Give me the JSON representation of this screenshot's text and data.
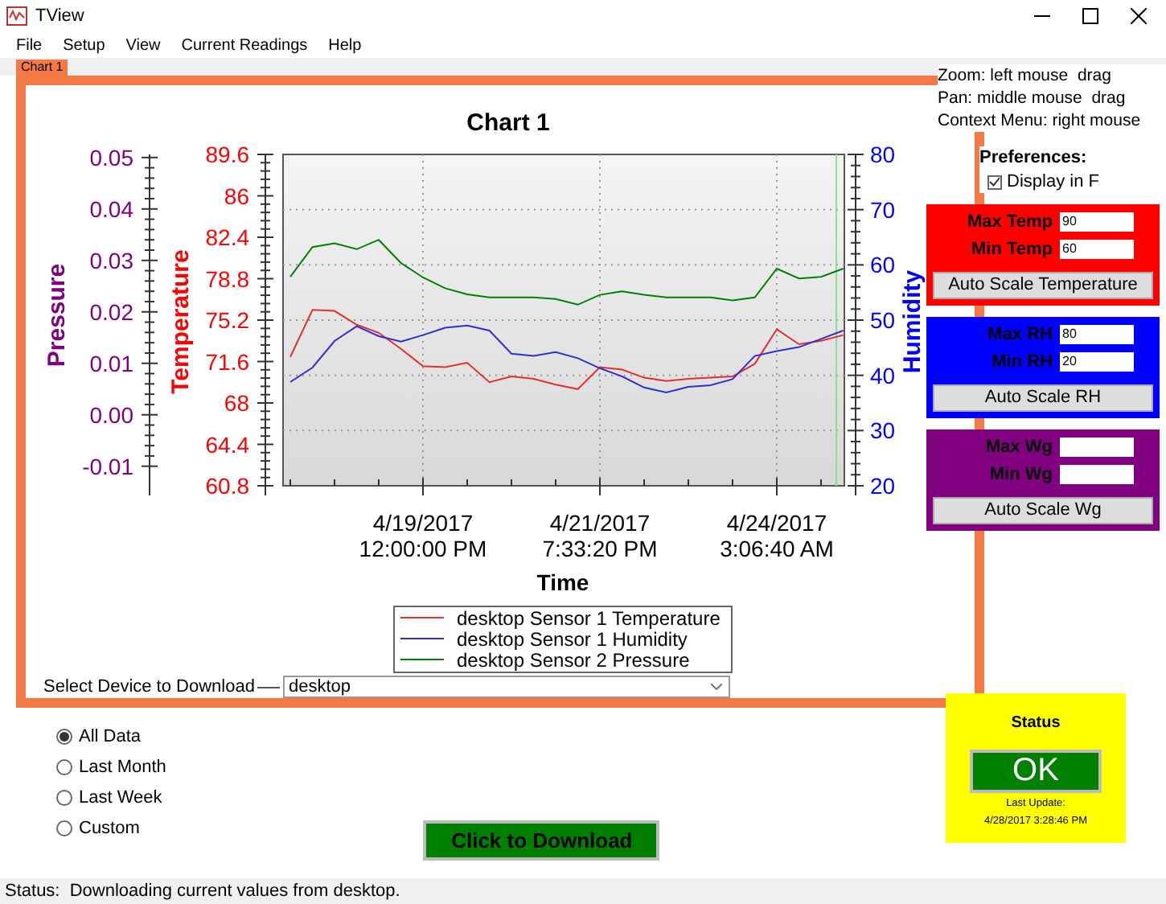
{
  "window": {
    "title": "TView"
  },
  "menu": [
    "File",
    "Setup",
    "View",
    "Current Readings",
    "Help"
  ],
  "tabs": [
    {
      "label": "Chart 1",
      "selected": true
    }
  ],
  "chart": {
    "chart_data": {
      "type": "line",
      "title": "Chart 1",
      "xlabel": "Time",
      "grid": true,
      "legend": "bottom",
      "categories": [
        null,
        null,
        null,
        null,
        null,
        null,
        "4/19/2017\n12:00:00 PM",
        null,
        null,
        null,
        null,
        null,
        null,
        null,
        "4/21/2017\n7:33:20 PM",
        null,
        null,
        null,
        null,
        null,
        null,
        null,
        "4/24/2017\n3:06:40 AM",
        null,
        null,
        null
      ],
      "ylabel": "Temperature",
      "ylim": [
        60.8,
        89.6
      ],
      "yticks": [
        {
          "value": 89.6,
          "label": "89.6"
        },
        {
          "value": 86,
          "label": "86"
        },
        {
          "value": 82.4,
          "label": "82.4"
        },
        {
          "value": 78.8,
          "label": "78.8"
        },
        {
          "value": 75.2,
          "label": "75.2"
        },
        {
          "value": 71.6,
          "label": "71.6"
        },
        {
          "value": 68,
          "label": "68"
        },
        {
          "value": 64.4,
          "label": "64.4"
        },
        {
          "value": 60.8,
          "label": "60.8"
        }
      ],
      "y2label": "Humidity",
      "y2lim": [
        20,
        80
      ],
      "y2ticks": [
        {
          "value": 80,
          "label": "80"
        },
        {
          "value": 70,
          "label": "70"
        },
        {
          "value": 60,
          "label": "60"
        },
        {
          "value": 50,
          "label": "50"
        },
        {
          "value": 40,
          "label": "40"
        },
        {
          "value": 30,
          "label": "30"
        },
        {
          "value": 20,
          "label": "20"
        }
      ],
      "y3label": "Pressure",
      "y3lim": [
        -0.0138,
        0.0506
      ],
      "y3ticks": [
        {
          "value": 0.05,
          "label": "0.05"
        },
        {
          "value": 0.04,
          "label": "0.04"
        },
        {
          "value": 0.03,
          "label": "0.03"
        },
        {
          "value": 0.02,
          "label": "0.02"
        },
        {
          "value": 0.01,
          "label": "0.01"
        },
        {
          "value": 0,
          "label": "0.00"
        },
        {
          "value": -0.01,
          "label": "-0.01"
        }
      ],
      "series": [
        {
          "name": "desktop Sensor 1 Temperature",
          "color": "#e03030",
          "values": [
            72.0,
            76.1,
            76.0,
            74.8,
            74.1,
            72.7,
            71.2,
            71.1,
            71.5,
            69.8,
            70.3,
            70.1,
            69.6,
            69.2,
            71.1,
            70.9,
            70.2,
            69.9,
            70.1,
            70.2,
            70.3,
            71.4,
            74.4,
            73.1,
            73.4,
            73.9
          ]
        },
        {
          "name": "desktop Sensor 1 Humidity",
          "color": "#3030d0",
          "axis": "y2",
          "values": [
            38.8,
            41.4,
            46.2,
            48.9,
            47.1,
            46.1,
            47.3,
            48.6,
            49.0,
            48.1,
            43.9,
            43.5,
            44.2,
            43.1,
            41.3,
            39.8,
            37.8,
            36.9,
            37.9,
            38.2,
            39.3,
            43.5,
            44.4,
            45.1,
            46.6,
            48.1
          ]
        },
        {
          "name": "desktop Sensor 2 Pressure",
          "color": "#008000",
          "axis": "y3",
          "values": [
            0.0268,
            0.0326,
            0.0333,
            0.0322,
            0.034,
            0.0295,
            0.0267,
            0.0246,
            0.0234,
            0.0228,
            0.0228,
            0.0228,
            0.0225,
            0.0214,
            0.0233,
            0.024,
            0.0233,
            0.0228,
            0.0228,
            0.0228,
            0.0222,
            0.0228,
            0.0284,
            0.0265,
            0.0268,
            0.0284
          ]
        }
      ]
    }
  },
  "device_select": {
    "label": "Select Device to Download",
    "value": "desktop"
  },
  "hints": [
    "Zoom: left mouse  drag",
    "Pan: middle mouse  drag",
    "Context Menu: right mouse"
  ],
  "preferences": {
    "title": "Preferences:",
    "options": [
      {
        "label": "Display in F",
        "checked": true
      }
    ]
  },
  "scale_panels": [
    {
      "color": "#ff0000",
      "fields": [
        {
          "label": "Max Temp",
          "value": "90"
        },
        {
          "label": "Min Temp",
          "value": "60"
        }
      ],
      "button": "Auto Scale Temperature"
    },
    {
      "color": "#0000ff",
      "fields": [
        {
          "label": "Max RH",
          "value": "80"
        },
        {
          "label": "Min RH",
          "value": "20"
        }
      ],
      "button": "Auto Scale RH"
    },
    {
      "color": "#800080",
      "fields": [
        {
          "label": "Max Wg"
        },
        {
          "label": "Min Wg"
        }
      ],
      "button": "Auto Scale Wg"
    }
  ],
  "range_options": [
    {
      "label": "All Data",
      "selected": true
    },
    {
      "label": "Last Month",
      "selected": false
    },
    {
      "label": "Last Week",
      "selected": false
    },
    {
      "label": "Custom",
      "selected": false
    }
  ],
  "download_button": "Click to Download",
  "status_panel": {
    "title": "Status",
    "state": "OK",
    "last_update_label": "Last Update:",
    "last_update": "4/28/2017 3:28:46 PM"
  },
  "status_bar": "Status:  Downloading current values from desktop."
}
